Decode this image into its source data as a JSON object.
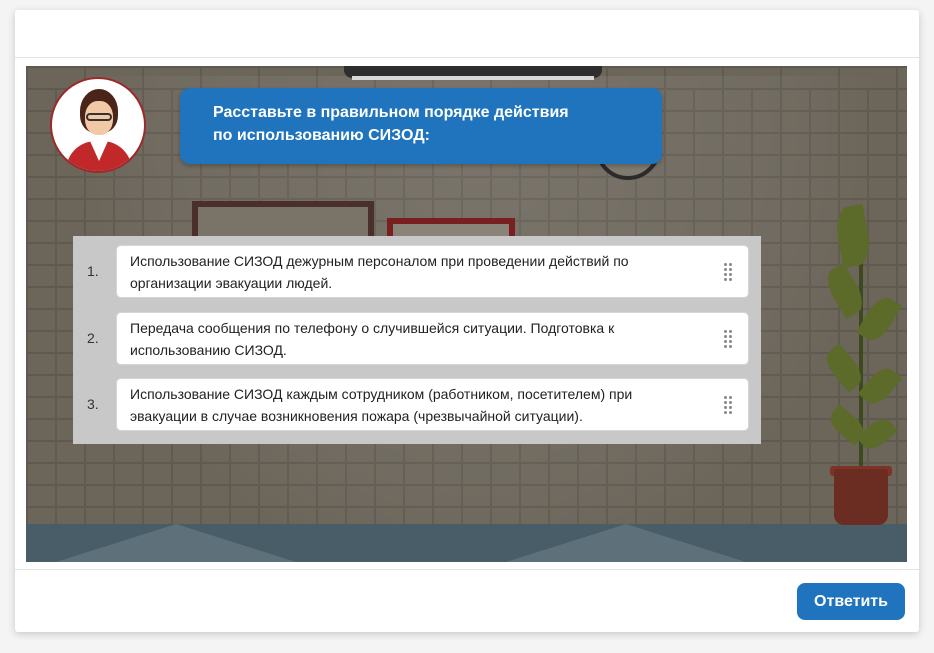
{
  "question": {
    "prompt_line1": "Расставьте в правильном порядке действия",
    "prompt_line2": "по использованию СИЗОД:"
  },
  "items": [
    {
      "number": "1.",
      "line1": "Использование СИЗОД дежурным персоналом при проведении действий по",
      "line2": "организации эвакуации людей."
    },
    {
      "number": "2.",
      "line1": "Передача сообщения по телефону о случившейся ситуации. Подготовка к",
      "line2": "использованию СИЗОД."
    },
    {
      "number": "3.",
      "line1": "Использование СИЗОД каждым сотрудником (работником, посетителем) при",
      "line2": "эвакуации в случае возникновения пожара (чрезвычайной ситуации)."
    }
  ],
  "footer": {
    "answer_label": "Ответить"
  },
  "colors": {
    "accent": "#1f74bd",
    "panel": "#c8c8c8",
    "avatar_border": "#9b2a2a"
  },
  "icons": {
    "drag": "drag-handle-icon",
    "avatar": "avatar-woman-illustration"
  }
}
